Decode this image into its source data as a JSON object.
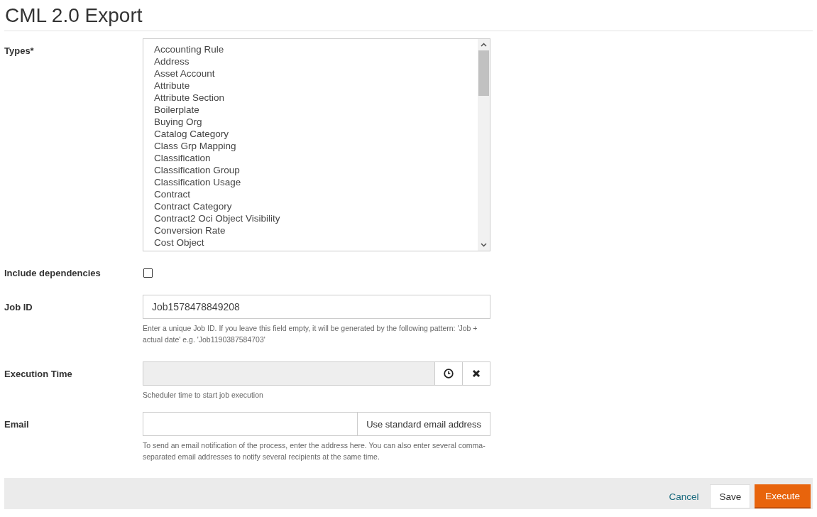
{
  "title": "CML 2.0 Export",
  "types": {
    "label": "Types*",
    "items": [
      {
        "label": "Accounting Rule",
        "selected": false
      },
      {
        "label": "Address",
        "selected": false
      },
      {
        "label": "Asset Account",
        "selected": false
      },
      {
        "label": "Attribute",
        "selected": false
      },
      {
        "label": "Attribute Section",
        "selected": false
      },
      {
        "label": "Boilerplate",
        "selected": false
      },
      {
        "label": "Buying Org",
        "selected": false
      },
      {
        "label": "Catalog Category",
        "selected": false
      },
      {
        "label": "Class Grp Mapping",
        "selected": false
      },
      {
        "label": "Classification",
        "selected": false
      },
      {
        "label": "Classification Group",
        "selected": false
      },
      {
        "label": "Classification Usage",
        "selected": false
      },
      {
        "label": "Contract",
        "selected": false
      },
      {
        "label": "Contract Category",
        "selected": false
      },
      {
        "label": "Contract2 Oci Object Visibility",
        "selected": false
      },
      {
        "label": "Conversion Rate",
        "selected": false
      },
      {
        "label": "Cost Object",
        "selected": false
      }
    ]
  },
  "include_dependencies": {
    "label": "Include dependencies",
    "checked": false
  },
  "job_id": {
    "label": "Job ID",
    "value": "Job1578478849208",
    "help": "Enter a unique Job ID. If you leave this field empty, it will be generated by the following pattern: 'Job + actual date' e.g. 'Job1190387584703'"
  },
  "execution_time": {
    "label": "Execution Time",
    "disabled": true,
    "help": "Scheduler time to start job execution"
  },
  "email": {
    "label": "Email",
    "button": "Use standard email address",
    "help": "To send an email notification of the process, enter the address here. You can also enter several comma-separated email addresses to notify several recipients at the same time."
  },
  "footer": {
    "buttons": [
      {
        "label": "Cancel",
        "kind": "link"
      },
      {
        "label": "Save",
        "kind": "default"
      },
      {
        "label": "Execute",
        "kind": "primary"
      }
    ]
  }
}
